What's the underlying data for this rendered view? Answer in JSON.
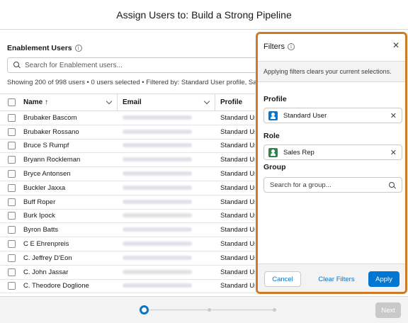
{
  "modal": {
    "title": "Assign Users to: Build a Strong Pipeline"
  },
  "users_section": {
    "title": "Enablement Users",
    "search_placeholder": "Search for Enablement users...",
    "status": "Showing 200 of 998 users • 0 users selected • Filtered by: Standard User profile, Sales Rep role"
  },
  "table": {
    "columns": {
      "name": "Name ↑",
      "email": "Email",
      "profile": "Profile"
    },
    "rows": [
      {
        "name": "Brubaker Bascom",
        "profile": "Standard User"
      },
      {
        "name": "Brubaker Rossano",
        "profile": "Standard User"
      },
      {
        "name": "Bruce S Rumpf",
        "profile": "Standard User"
      },
      {
        "name": "Bryann Rockleman",
        "profile": "Standard User"
      },
      {
        "name": "Bryce Antonsen",
        "profile": "Standard User"
      },
      {
        "name": "Buckler Jaxxa",
        "profile": "Standard User"
      },
      {
        "name": "Buff Roper",
        "profile": "Standard User"
      },
      {
        "name": "Burk Ipock",
        "profile": "Standard User"
      },
      {
        "name": "Byron Batts",
        "profile": "Standard User"
      },
      {
        "name": "C E Ehrenpreis",
        "profile": "Standard User"
      },
      {
        "name": "C. Jeffrey D'Eon",
        "profile": "Standard User"
      },
      {
        "name": "C. John Jassar",
        "profile": "Standard User"
      },
      {
        "name": "C. Theodore Doglione",
        "profile": "Standard User"
      }
    ]
  },
  "filters": {
    "title": "Filters",
    "note": "Applying filters clears your current selections.",
    "profile_label": "Profile",
    "profile_value": "Standard User",
    "profile_icon_color": "#0176d3",
    "role_label": "Role",
    "role_value": "Sales Rep",
    "role_icon_color": "#2e844a",
    "group_label": "Group",
    "group_placeholder": "Search for a group...",
    "cancel_label": "Cancel",
    "clear_label": "Clear Filters",
    "apply_label": "Apply"
  },
  "footer": {
    "next_label": "Next",
    "current_step": 1,
    "total_steps": 3
  }
}
